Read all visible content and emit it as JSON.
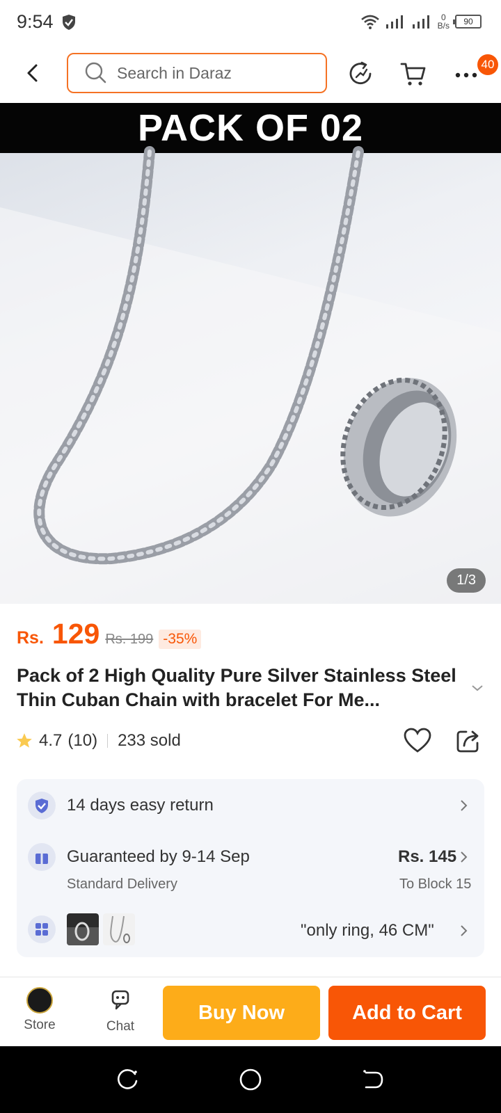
{
  "status_bar": {
    "time": "9:54",
    "speed_value": "0",
    "speed_unit": "B/s",
    "battery": "90"
  },
  "header": {
    "search_placeholder": "Search in Daraz",
    "more_badge": "40"
  },
  "product": {
    "banner": "PACK OF 02",
    "image_counter": "1/3",
    "price_prefix": "Rs.",
    "price": "129",
    "original_price": "Rs. 199",
    "discount": "-35%",
    "title": "Pack of 2 High Quality Pure Silver Stainless Steel Thin Cuban Chain with bracelet For Me...",
    "rating": "4.7",
    "reviews": "(10)",
    "sold": "233 sold"
  },
  "info": {
    "return_text": "14 days easy return",
    "delivery_text": "Guaranteed by 9-14 Sep",
    "delivery_sub": "Standard Delivery",
    "delivery_price": "Rs. 145",
    "delivery_location": "To Block 15",
    "variant_text": "\"only ring, 46 CM\""
  },
  "bottom_bar": {
    "store_label": "Store",
    "chat_label": "Chat",
    "buy_now": "Buy Now",
    "add_to_cart": "Add to Cart"
  },
  "colors": {
    "accent": "#f85606",
    "buy_now": "#fdac19",
    "search_border": "#f57224"
  }
}
